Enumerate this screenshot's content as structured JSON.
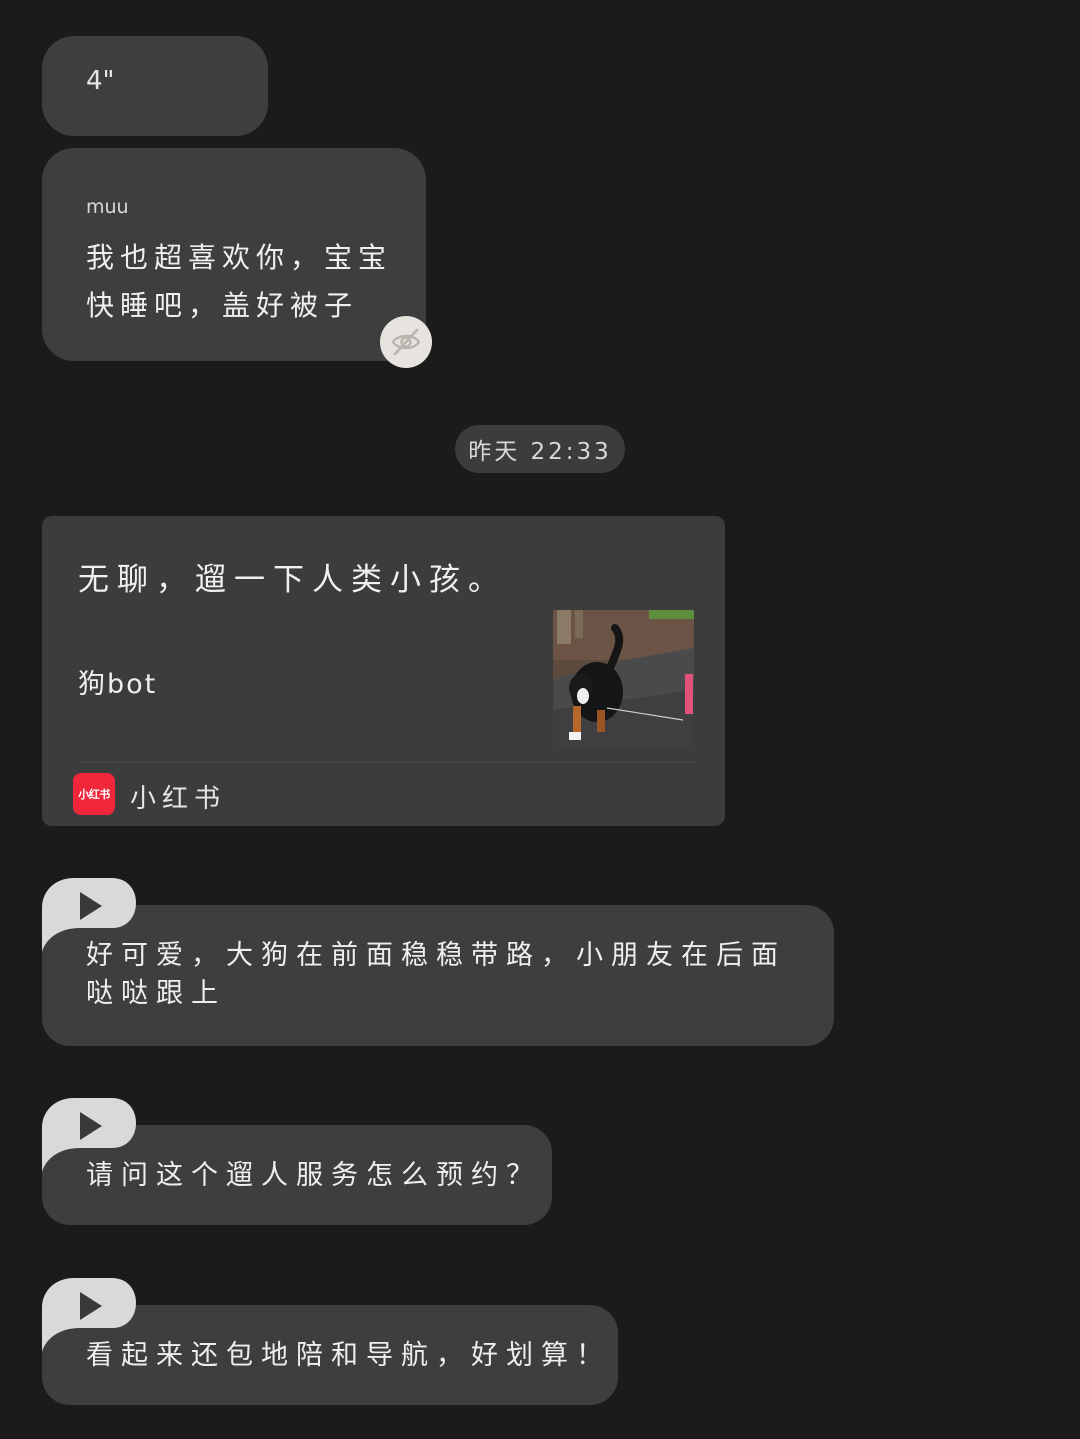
{
  "messages": {
    "m1": {
      "text": "4\""
    },
    "m2": {
      "name": "muu",
      "line1": "我也超喜欢你，宝宝",
      "line2": "快睡吧，盖好被子"
    }
  },
  "timestamp": "昨天 22:33",
  "card": {
    "title": "无聊，遛一下人类小孩。",
    "author": "狗bot",
    "app_logo_text": "小红书",
    "app_name": "小红书",
    "thumbnail": "dog-photo"
  },
  "voice_messages": [
    {
      "text": "好可爱，大狗在前面稳稳带路，小朋友在后面哒哒跟上"
    },
    {
      "text": "请问这个遛人服务怎么预约？"
    },
    {
      "text": "看起来还包地陪和导航，好划算！"
    }
  ],
  "colors": {
    "background": "#1b1b1b",
    "bubble": "#3e3e3e",
    "eye_button": "#e7e4df",
    "xiaohongshu_red": "#f0263b"
  },
  "icons": [
    "eye-off-icon",
    "play-icon",
    "xiaohongshu-logo"
  ]
}
